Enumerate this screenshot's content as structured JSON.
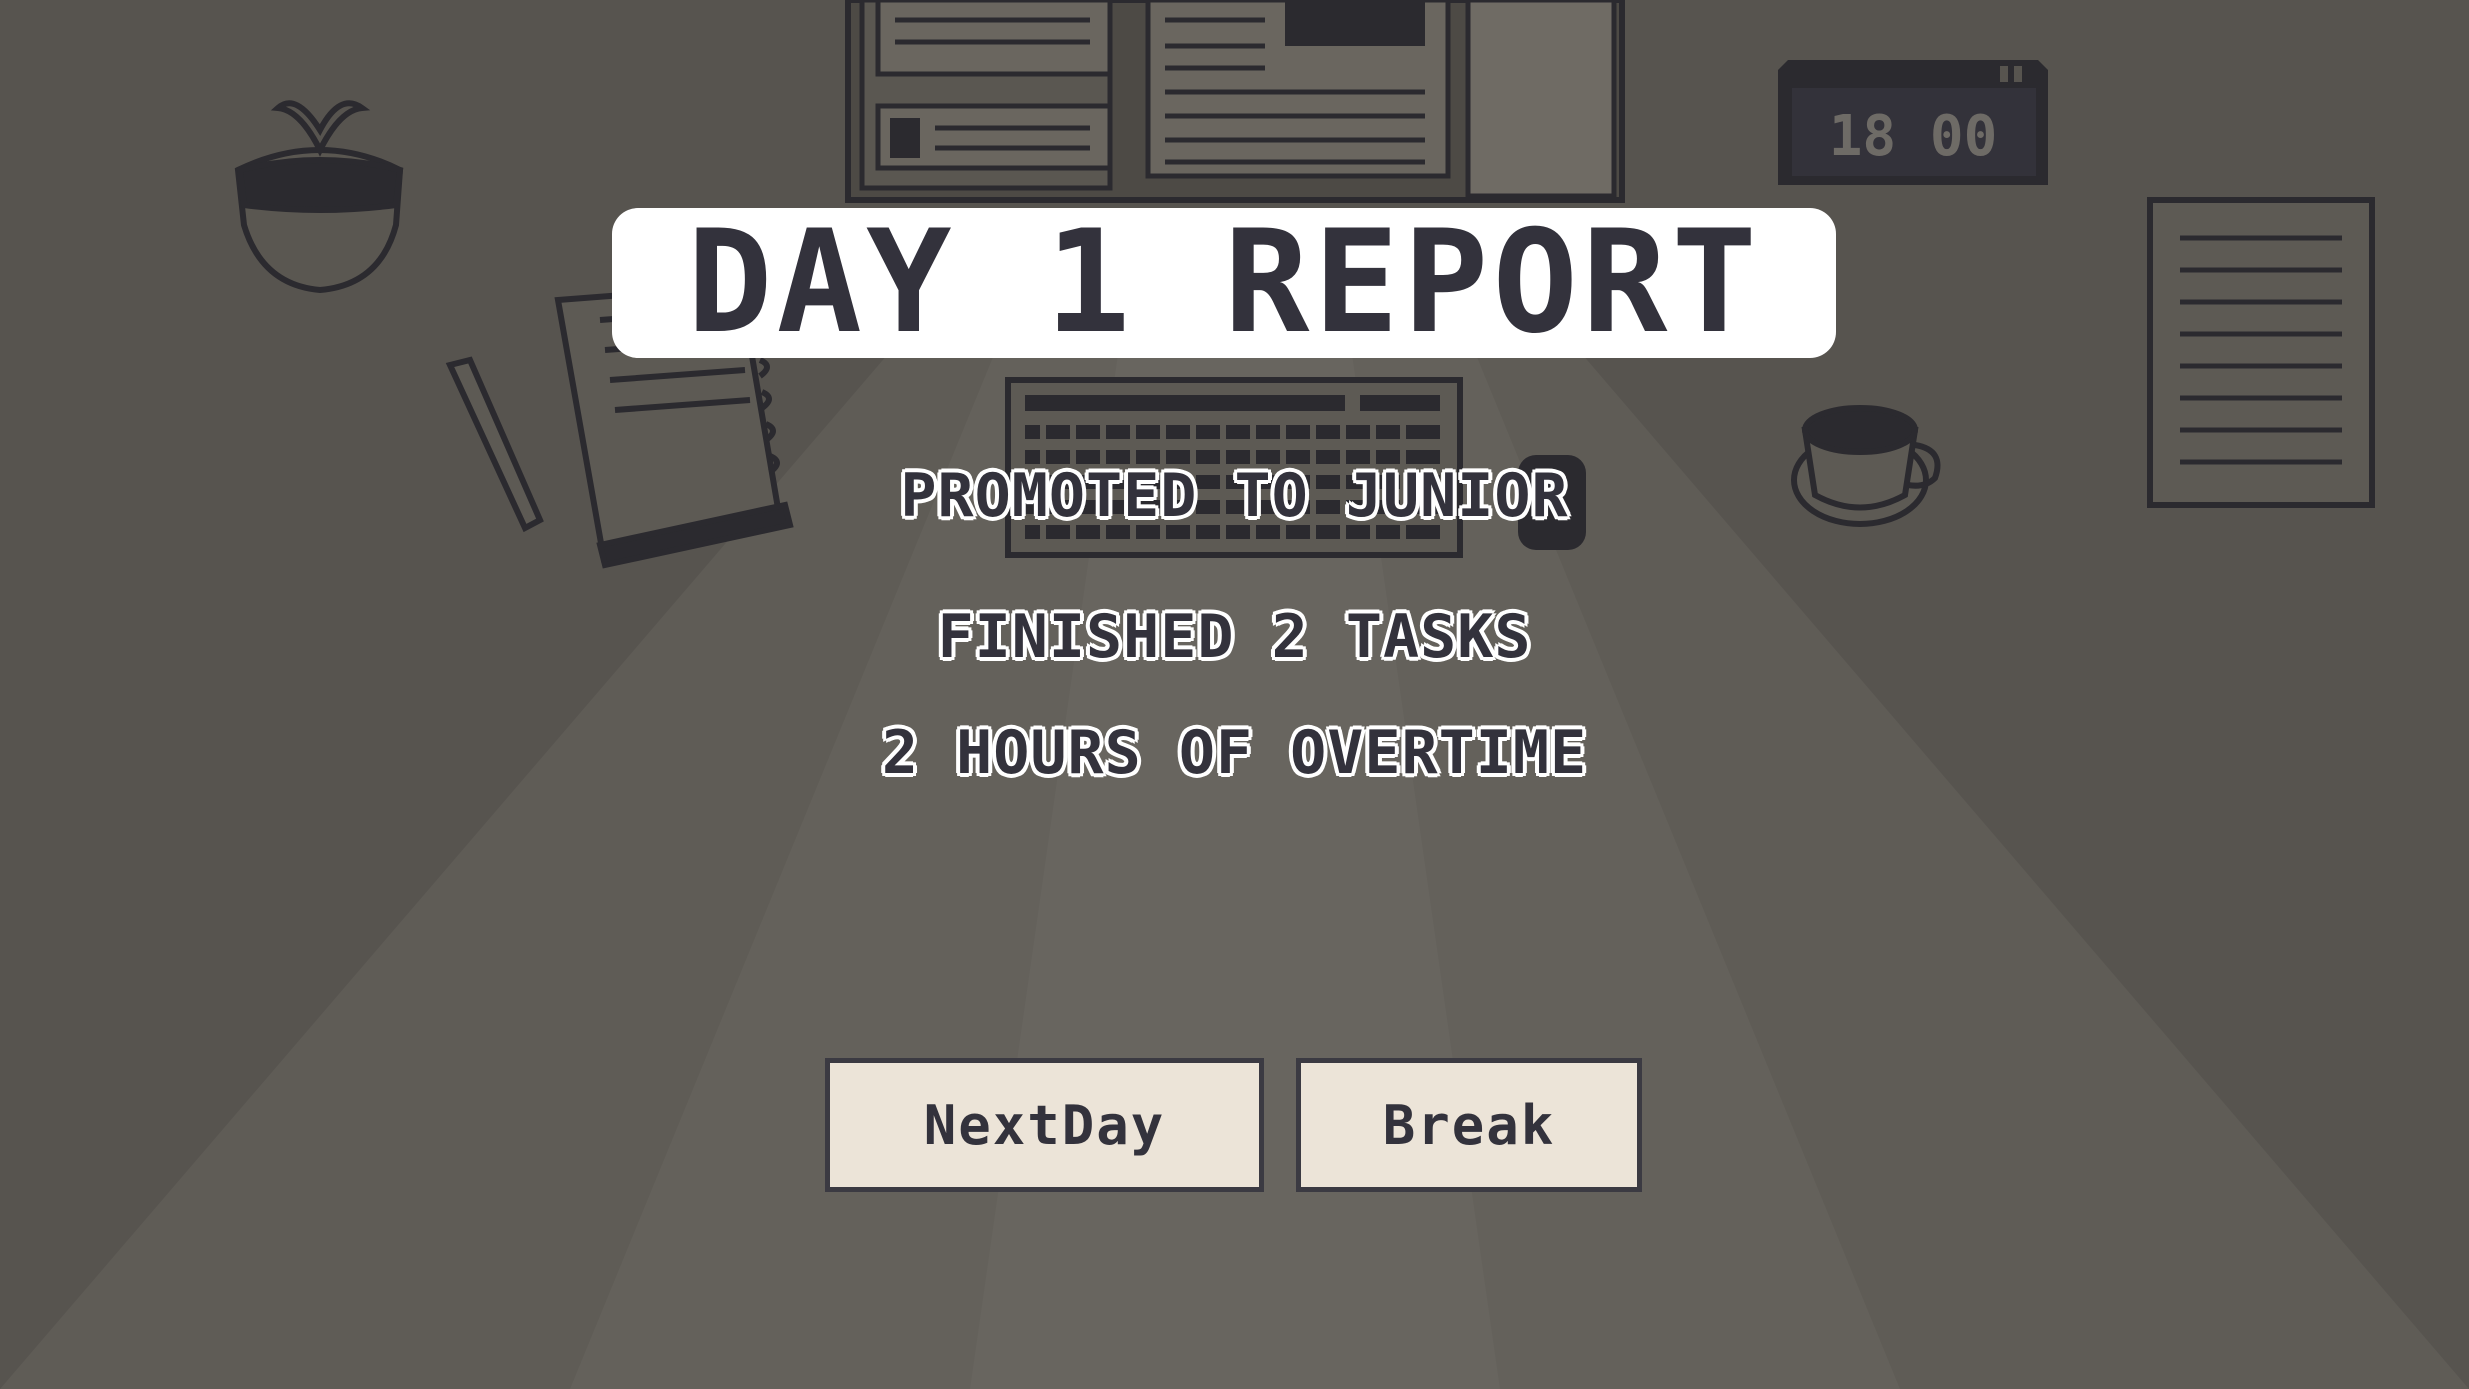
{
  "clock": {
    "time": "18 00"
  },
  "report": {
    "title": "DAY 1 REPORT",
    "lines": [
      "PROMOTED TO JUNIOR",
      "FINISHED 2 TASKS",
      "2 HOURS OF OVERTIME"
    ]
  },
  "buttons": {
    "next_day": "NextDay",
    "break": "Break"
  },
  "colors": {
    "background": "#57544f",
    "ink": "#33323c",
    "button_bg": "#ece4d8",
    "title_bg": "#ffffff"
  }
}
